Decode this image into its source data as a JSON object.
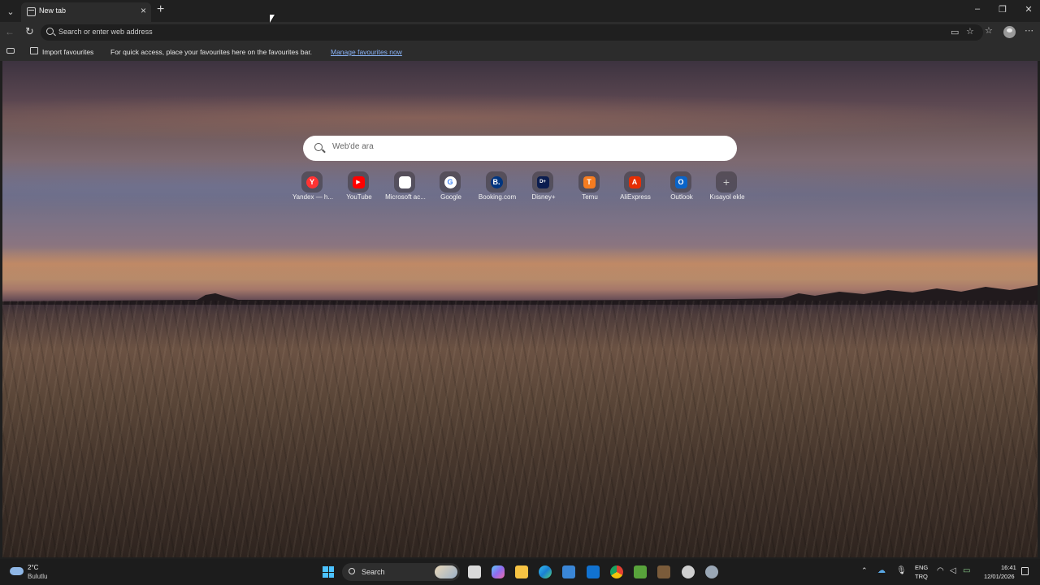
{
  "browser": {
    "tab": {
      "title": "New tab",
      "close": "×"
    },
    "new_tab": "+",
    "window_controls": {
      "minimize": "–",
      "maximize": "❐",
      "close": "✕"
    },
    "address_placeholder": "Search or enter web address",
    "favourites_bar": {
      "import_label": "Import favourites",
      "message": "For quick access, place your favourites here on the favourites bar.",
      "manage_link": "Manage favourites now"
    }
  },
  "newtab": {
    "search_placeholder": "Web'de ara",
    "quick_links": [
      {
        "label": "Yandex — h...",
        "glyph": "Y",
        "color": "#f33"
      },
      {
        "label": "YouTube",
        "glyph": "▶",
        "color": "#ff0000"
      },
      {
        "label": "Microsoft ac...",
        "glyph": "",
        "color": "#ffffff"
      },
      {
        "label": "Google",
        "glyph": "G",
        "color": "#ffffff"
      },
      {
        "label": "Booking.com",
        "glyph": "B.",
        "color": "#003580"
      },
      {
        "label": "Disney+",
        "glyph": "D+",
        "color": "#0b1d4f"
      },
      {
        "label": "Temu",
        "glyph": "T",
        "color": "#f57c20"
      },
      {
        "label": "AliExpress",
        "glyph": "A",
        "color": "#e62e04"
      },
      {
        "label": "Outlook",
        "glyph": "O",
        "color": "#0a64c9"
      },
      {
        "label": "Kısayol ekle",
        "glyph": "+",
        "color": "#5a5a5a"
      }
    ]
  },
  "taskbar": {
    "weather": {
      "temp": "2°C",
      "desc": "Bulutlu"
    },
    "search_label": "Search",
    "apps": [
      {
        "name": "task-view",
        "color": "#d9d9d9"
      },
      {
        "name": "copilot",
        "color": "#8f6cf0"
      },
      {
        "name": "file-explorer",
        "color": "#f6c343"
      },
      {
        "name": "edge",
        "color": "#1ea3d8"
      },
      {
        "name": "store",
        "color": "#3a86d6"
      },
      {
        "name": "outlook",
        "color": "#1172d0"
      },
      {
        "name": "chrome",
        "color": "#e34133"
      },
      {
        "name": "minecraft",
        "color": "#58a33b"
      },
      {
        "name": "minecraft-launcher",
        "color": "#7a5b3a"
      },
      {
        "name": "snipping-tool",
        "color": "#cfcfcf"
      },
      {
        "name": "settings",
        "color": "#9aa7b5"
      }
    ],
    "language": {
      "code": "ENG",
      "layout": "TRQ"
    },
    "clock": {
      "time": "16:41",
      "date": "12/01/2026"
    }
  }
}
